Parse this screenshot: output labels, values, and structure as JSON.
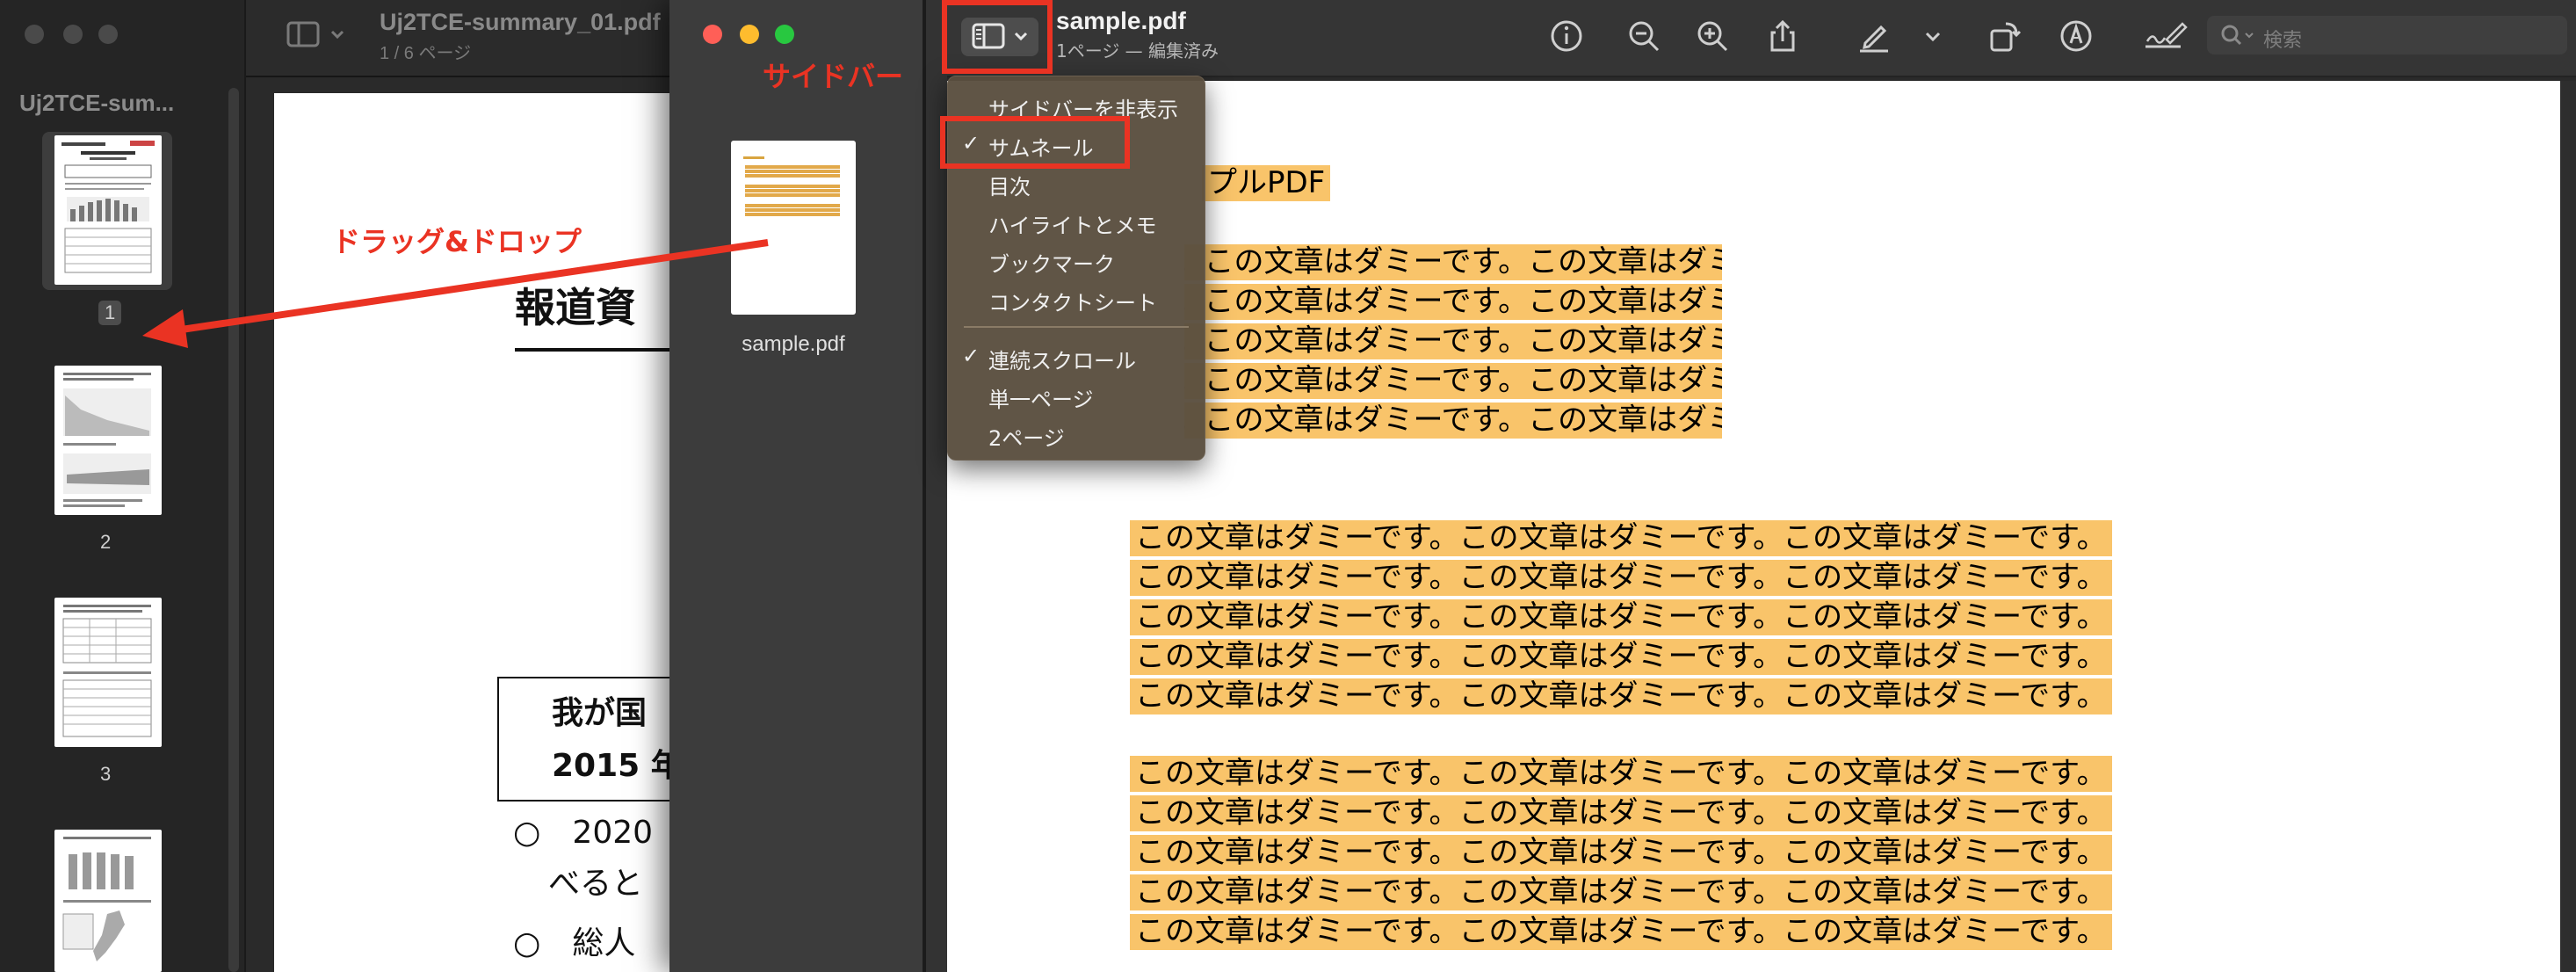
{
  "back_window": {
    "sidebar_title": "Uj2TCE-sum...",
    "title": "Uj2TCE-summary_01.pdf",
    "subtitle": "1 / 6 ページ",
    "thumbnails": [
      {
        "label": "1"
      },
      {
        "label": "2"
      },
      {
        "label": "3"
      }
    ],
    "doc_heading": "報道資",
    "doc_box_line1": "我が国",
    "doc_box_line2": "2015 年",
    "doc_line1": "○　2020",
    "doc_line2": "べると",
    "doc_line3": "○　総人"
  },
  "middle_window": {
    "file_name": "sample.pdf"
  },
  "front_window": {
    "title": "sample.pdf",
    "subtitle": "1ページ — 編集済み",
    "search_placeholder": "検索",
    "doc_title": "プルPDF",
    "highlight_line": "この文章はダミーです。この文章はダミーです。この文章はダミーです。",
    "partial_line": "この文章はダミーです。この文章はダミーです。この文章はダミーです。"
  },
  "sidebar_menu": {
    "items": [
      {
        "label": "サイドバーを非表示",
        "checked": false
      },
      {
        "label": "サムネール",
        "checked": true
      },
      {
        "label": "目次",
        "checked": false
      },
      {
        "label": "ハイライトとメモ",
        "checked": false
      },
      {
        "label": "ブックマーク",
        "checked": false
      },
      {
        "label": "コンタクトシート",
        "checked": false
      },
      {
        "label": "連続スクロール",
        "checked": true
      },
      {
        "label": "単一ページ",
        "checked": false
      },
      {
        "label": "2ページ",
        "checked": false
      }
    ],
    "check_mark": "✓"
  },
  "annotations": {
    "sidebar_label": "サイドバー",
    "drag_drop_label": "ドラッグ&ドロップ",
    "color": "#ea3323"
  },
  "icons": [
    "sidebar-icon",
    "chevron-down-icon",
    "info-icon",
    "zoom-out-icon",
    "zoom-in-icon",
    "share-icon",
    "markup-pen-icon",
    "rotate-icon",
    "markup-circle-icon",
    "signature-icon",
    "search-icon"
  ]
}
